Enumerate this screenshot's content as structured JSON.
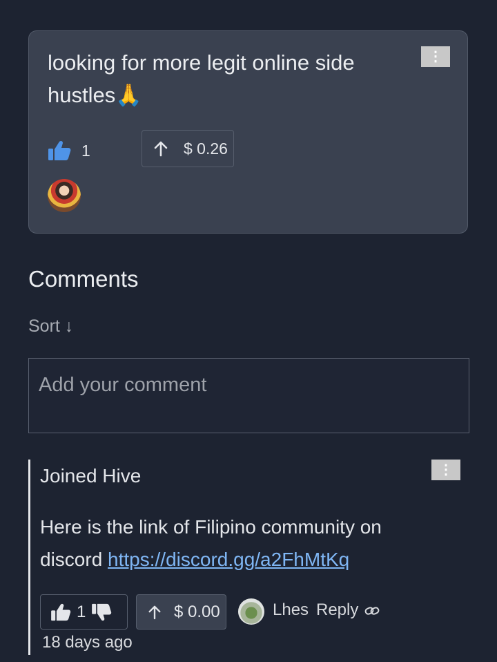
{
  "post": {
    "text": "looking for more legit online side hustles🙏",
    "likes": "1",
    "tip": "$ 0.26",
    "menu_glyph": "⋮"
  },
  "comments": {
    "heading": "Comments",
    "sort_label": "Sort ↓",
    "input_placeholder": "Add your comment",
    "items": [
      {
        "title": "Joined Hive",
        "text": "Here is the link of Filipino community on discord ",
        "link_text": "https://discord.gg/a2FhMtKq",
        "likes": "1",
        "tip": "$ 0.00",
        "author": "Lhes",
        "reply_label": "Reply",
        "time": "18 days ago",
        "menu_glyph": "⋮"
      }
    ]
  },
  "colors": {
    "background": "#1d2331",
    "card": "#3a4150",
    "like_blue": "#4f94e8",
    "link": "#7fb6f4"
  },
  "icons": [
    "thumbs-up-icon",
    "arrow-up-icon",
    "thumbs-down-icon",
    "link-icon",
    "kebab-menu-icon"
  ]
}
